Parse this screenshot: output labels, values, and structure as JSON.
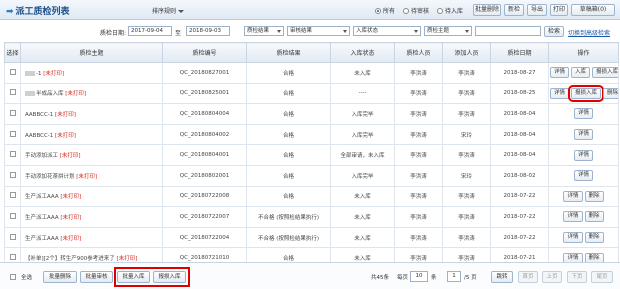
{
  "header": {
    "title": "派工质检列表",
    "sort_label": "排序规则",
    "radios": [
      {
        "label": "所有",
        "checked": true
      },
      {
        "label": "待审核",
        "checked": false
      },
      {
        "label": "待入库",
        "checked": false
      }
    ],
    "buttons": [
      "批量删除",
      "新检",
      "导出",
      "打印",
      "草稿箱(0)"
    ]
  },
  "filters": {
    "date_label": "质检日期:",
    "date_from": "2017-09-04",
    "to_label": "至",
    "date_to": "2018-09-03",
    "selects": [
      "质检结果",
      "审核结果",
      "入库状态",
      "质检主题"
    ],
    "search_label": "检索",
    "advanced_link": "切换到高级检索"
  },
  "table": {
    "headers": [
      "选择",
      "质检主题",
      "质检编号",
      "质检结果",
      "入库状态",
      "质检人员",
      "添加人员",
      "质检日期",
      "操作"
    ],
    "rows": [
      {
        "theme_pre": "-1",
        "theme_tag": "[未打印]",
        "blurred": true,
        "code": "QC_20180827001",
        "result": "合格",
        "status": "未入库",
        "inspector": "李洪涛",
        "adder": "李洪涛",
        "date": "2018-08-27",
        "actions": [
          "详情",
          "入库",
          "报损入库"
        ]
      },
      {
        "theme_pre": "半成品入库",
        "theme_tag": "[未打印]",
        "blurred": true,
        "code": "QC_20180825001",
        "result": "合格",
        "status": "----",
        "inspector": "李洪涛",
        "adder": "李洪涛",
        "date": "2018-08-25",
        "actions": [
          "详情",
          "报损入库",
          "删除"
        ]
      },
      {
        "theme_pre": "AABBCC-1",
        "theme_tag": "[未打印]",
        "blurred": false,
        "code": "QC_20180804004",
        "result": "合格",
        "status": "入库完毕",
        "inspector": "李洪涛",
        "adder": "李洪涛",
        "date": "2018-08-04",
        "actions": [
          "详情"
        ]
      },
      {
        "theme_pre": "AABBCC-1",
        "theme_tag": "[未打印]",
        "blurred": false,
        "code": "QC_20180804002",
        "result": "合格",
        "status": "入库完毕",
        "inspector": "李洪涛",
        "adder": "宋玲",
        "date": "2018-08-04",
        "actions": [
          "详情"
        ]
      },
      {
        "theme_pre": "手动添加派工",
        "theme_tag": "[未打印]",
        "blurred": false,
        "code": "QC_20180804001",
        "result": "合格",
        "status": "全部审请，未入库",
        "inspector": "李洪涛",
        "adder": "李洪涛",
        "date": "2018-08-04",
        "actions": [
          "详情"
        ]
      },
      {
        "theme_pre": "手动添加花茶拼计划",
        "theme_tag": "[未打印]",
        "blurred": false,
        "code": "QC_20180802001",
        "result": "合格",
        "status": "入库完毕",
        "inspector": "李洪涛",
        "adder": "宋玲",
        "date": "2018-08-02",
        "actions": [
          "详情"
        ]
      },
      {
        "theme_pre": "生产派工AAA",
        "theme_tag": "[未打印]",
        "blurred": false,
        "code": "QC_20180722008",
        "result": "合格",
        "status": "未入库",
        "inspector": "李洪涛",
        "adder": "李洪涛",
        "date": "2018-07-22",
        "actions": [
          "详情",
          "删除"
        ]
      },
      {
        "theme_pre": "生产派工AAA",
        "theme_tag": "[未打印]",
        "blurred": false,
        "code": "QC_20180722007",
        "result": "不合格 (按照检结果执行)",
        "status": "未入库",
        "inspector": "李洪涛",
        "adder": "李洪涛",
        "date": "2018-07-22",
        "actions": [
          "详情",
          "删除"
        ]
      },
      {
        "theme_pre": "生产派工AAA",
        "theme_tag": "[未打印]",
        "blurred": false,
        "code": "QC_20180722004",
        "result": "不合格 (按照检结果执行)",
        "status": "未入库",
        "inspector": "李洪涛",
        "adder": "李洪涛",
        "date": "2018-07-22",
        "actions": [
          "详情",
          "删除"
        ]
      },
      {
        "theme_pre": "【补单][2个】转生产900参考进来了",
        "theme_tag": "[未打印]",
        "blurred": false,
        "code": "QC_20180721010",
        "result": "合格",
        "status": "未入库",
        "inspector": "李洪涛",
        "adder": "李洪涛",
        "date": "2018-07-21",
        "actions": [
          "详情",
          "删除"
        ]
      }
    ]
  },
  "footer": {
    "select_all": "全选",
    "buttons": [
      "批量删除",
      "批量审核",
      "批量入库",
      "报损入库"
    ],
    "total": "共45条",
    "per_page_label": "每页",
    "per_page": "10",
    "unit": "条",
    "page": "1",
    "pages": "/5 页",
    "nav": [
      "跳转",
      "首页",
      "上页",
      "下页",
      "尾页"
    ]
  }
}
